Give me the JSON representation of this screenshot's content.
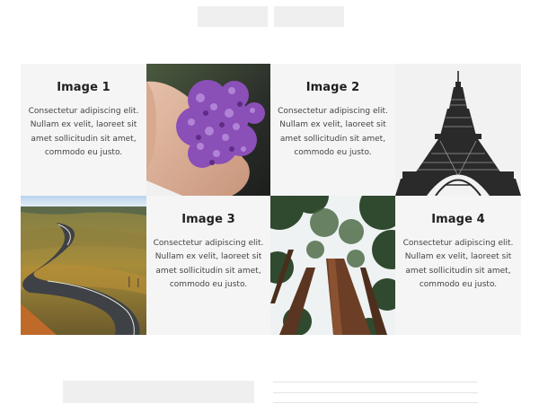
{
  "header": {
    "buttons": [
      {
        "label": ""
      },
      {
        "label": ""
      }
    ]
  },
  "grid": {
    "cards": [
      {
        "title": "Image 1",
        "body": "Consectetur adipiscing elit. Nullam ex velit, laoreet sit amet sollicitudin sit amet, commodo eu justo."
      },
      {
        "title": "Image 2",
        "body": "Consectetur adipiscing elit. Nullam ex velit, laoreet sit amet sollicitudin sit amet, commodo eu justo."
      },
      {
        "title": "Image 3",
        "body": "Consectetur adipiscing elit. Nullam ex velit, laoreet sit amet sollicitudin sit amet, commodo eu justo."
      },
      {
        "title": "Image 4",
        "body": "Consectetur adipiscing elit. Nullam ex velit, laoreet sit amet sollicitudin sit amet, commodo eu justo."
      }
    ],
    "photos": [
      {
        "subject": "hand holding purple lilac flowers"
      },
      {
        "subject": "eiffel tower black and white"
      },
      {
        "subject": "winding road through hills"
      },
      {
        "subject": "redwood trees looking up"
      }
    ]
  },
  "colors": {
    "card_background": "#f5f5f5",
    "placeholder_gray": "#efefef",
    "line_gray": "#e3e3e3",
    "title_text": "#1f1f1f",
    "body_text": "#444444"
  }
}
